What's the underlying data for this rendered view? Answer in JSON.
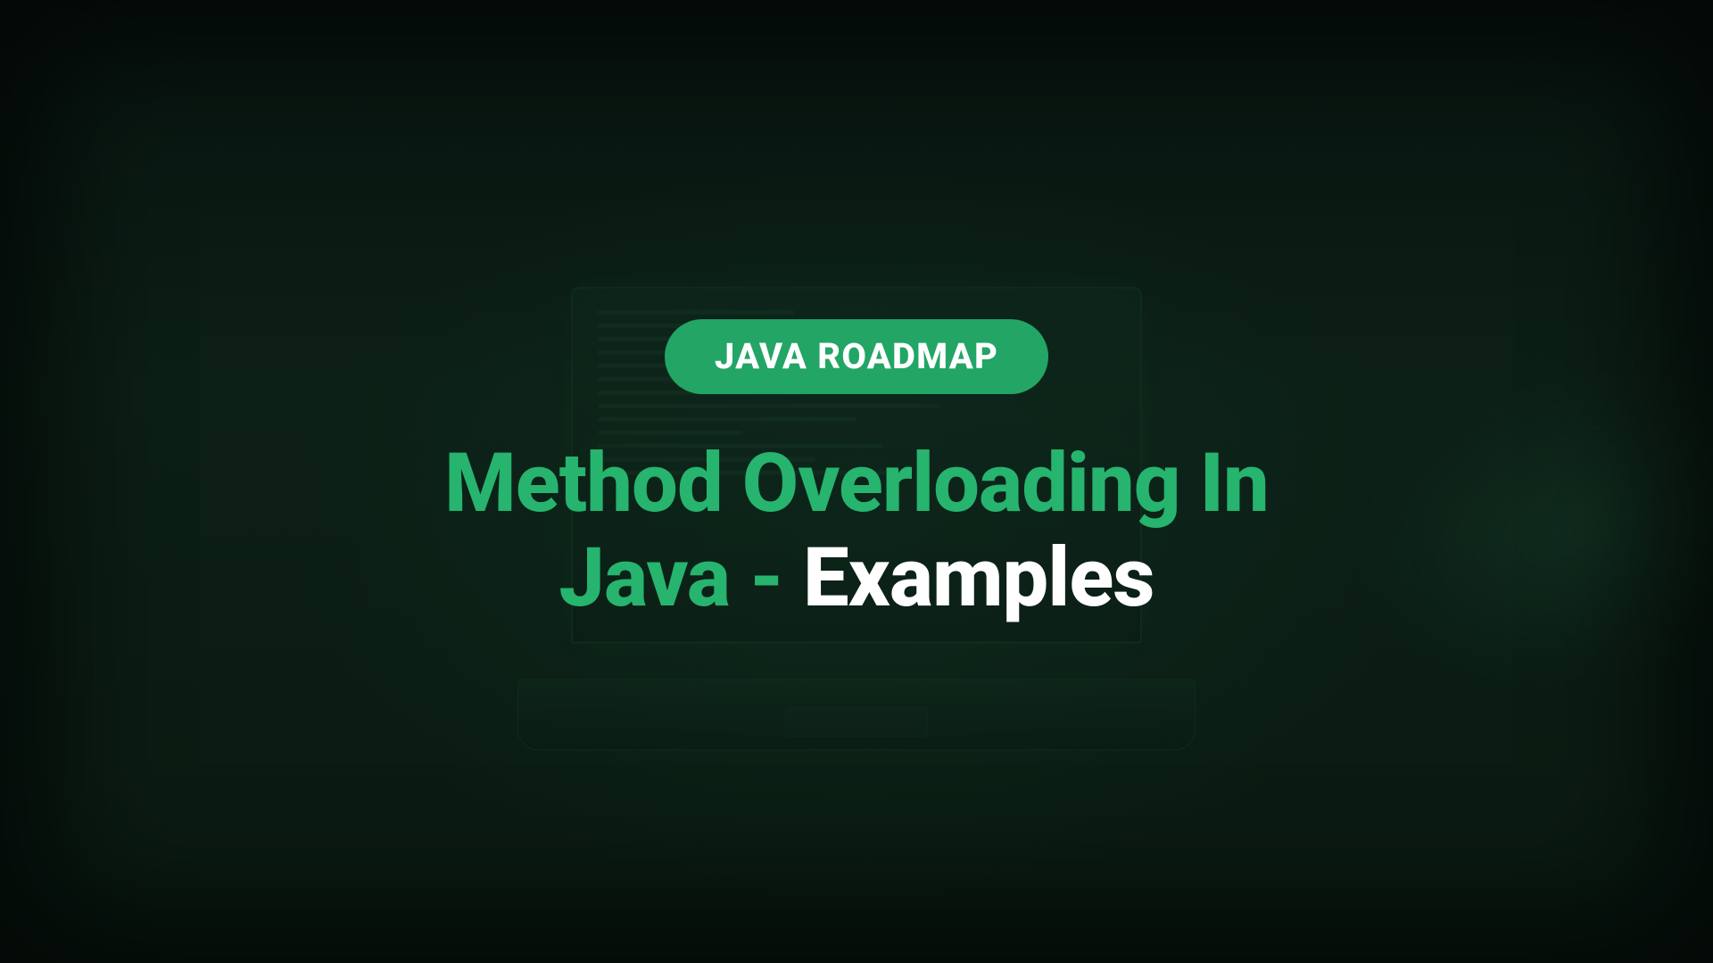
{
  "badge": {
    "label": "JAVA ROADMAP"
  },
  "title": {
    "part1": "Method Overloading In",
    "part2": "Java - ",
    "part3": "Examples"
  },
  "colors": {
    "accent": "#22a565",
    "title_green": "#26b46e",
    "title_white": "#ffffff",
    "bg_base": "#0a1a12"
  }
}
